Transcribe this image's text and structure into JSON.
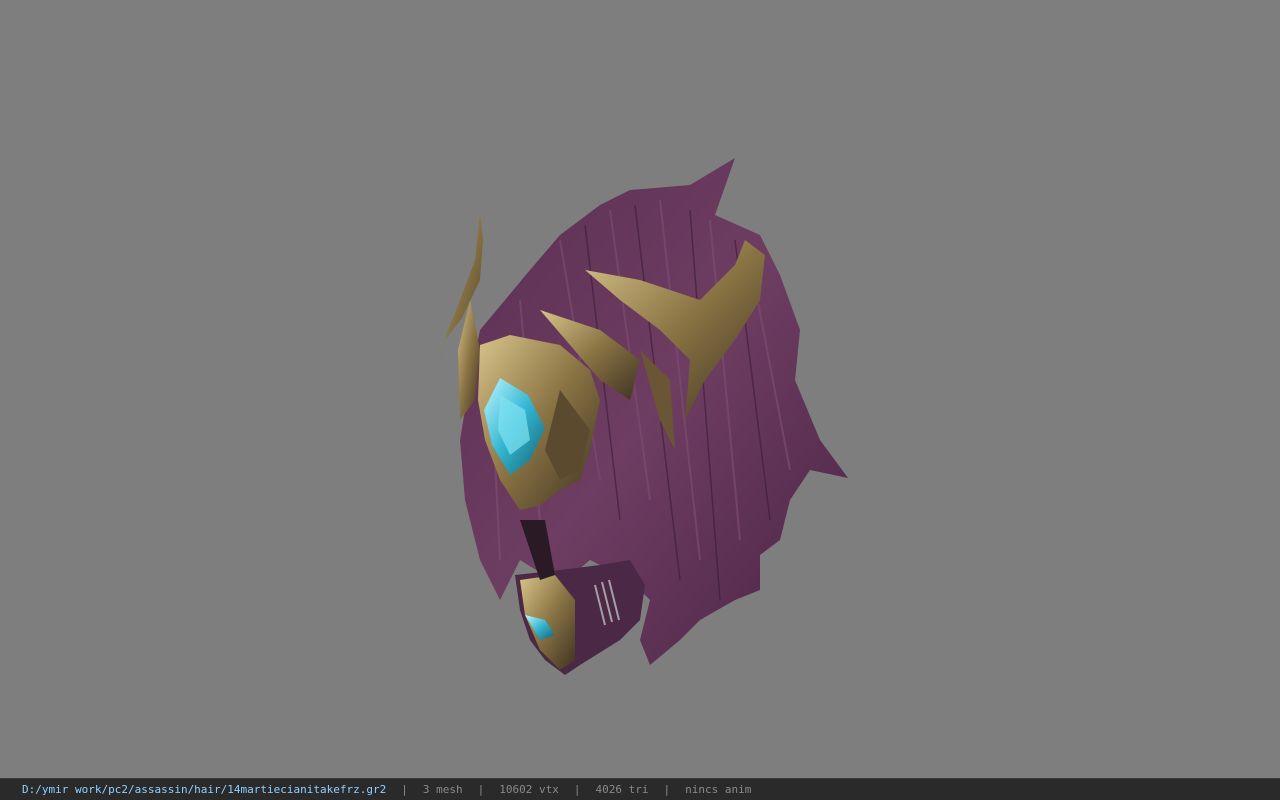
{
  "app": {
    "background_color": "#7e7e7e"
  },
  "model": {
    "description": "purple spiky hair with gold horned headpiece and cyan gem"
  },
  "status": {
    "file_path": "D:/ymir work/pc2/assassin/hair/14martiecianitakefrz.gr2",
    "mesh": "3 mesh",
    "vertices": "10602 vtx",
    "triangles": "4026 tri",
    "anim": "nincs anim",
    "separator": "|",
    "path_color": "#8fd0ff",
    "text_color": "#8a8a8a"
  }
}
